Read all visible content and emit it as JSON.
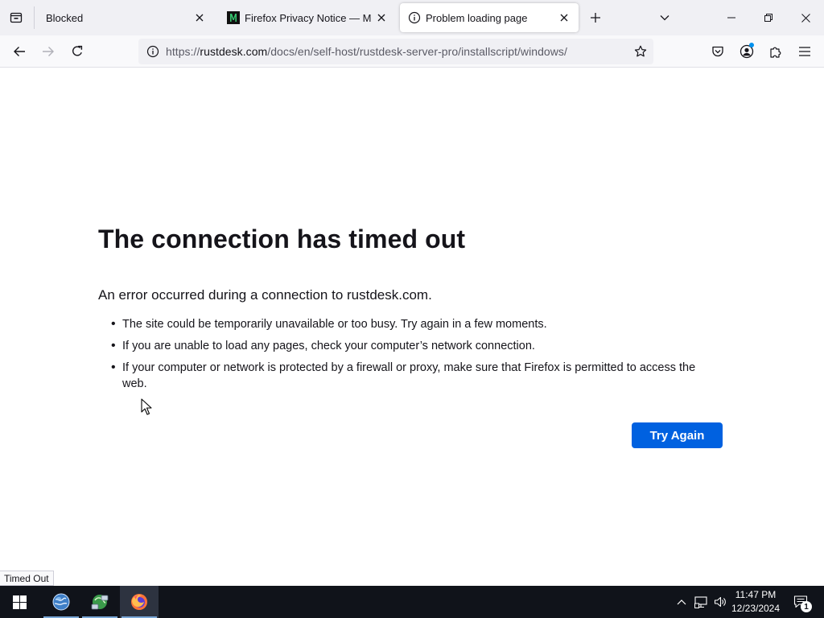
{
  "tabs": [
    {
      "title": "Blocked",
      "favicon": "none",
      "active": false
    },
    {
      "title": "Firefox Privacy Notice — Mozilla",
      "favicon": "mozilla-icon",
      "active": false
    },
    {
      "title": "Problem loading page",
      "favicon": "info-icon",
      "active": true
    }
  ],
  "navbar": {
    "url_prefix": "https://",
    "url_host": "rustdesk.com",
    "url_path": "/docs/en/self-host/rustdesk-server-pro/installscript/windows/"
  },
  "error_page": {
    "title": "The connection has timed out",
    "description": "An error occurred during a connection to rustdesk.com.",
    "bullets": [
      "The site could be temporarily unavailable or too busy. Try again in a few moments.",
      "If you are unable to load any pages, check your computer’s network connection.",
      "If your computer or network is protected by a firewall or proxy, make sure that Firefox is permitted to access the web."
    ],
    "try_again_label": "Try Again"
  },
  "status_bar": {
    "text": "Timed Out"
  },
  "taskbar": {
    "apps": [
      "globe-app-icon",
      "network-app-icon",
      "firefox-icon"
    ],
    "time": "11:47 PM",
    "date": "12/23/2024",
    "notification_count": "1"
  },
  "colors": {
    "accent": "#0061e0",
    "tabstrip_bg": "#f0f0f4",
    "navbar_bg": "#f9f9fb",
    "taskbar_bg": "#10131a"
  }
}
